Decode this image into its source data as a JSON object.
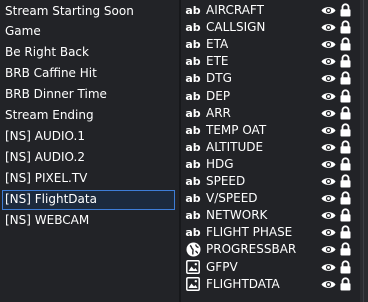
{
  "scenes": {
    "items": [
      {
        "label": "Stream Starting Soon",
        "selected": false
      },
      {
        "label": "Game",
        "selected": false
      },
      {
        "label": "Be Right Back",
        "selected": false
      },
      {
        "label": "BRB Caffine Hit",
        "selected": false
      },
      {
        "label": "BRB Dinner Time",
        "selected": false
      },
      {
        "label": "Stream Ending",
        "selected": false
      },
      {
        "label": "[NS] AUDIO.1",
        "selected": false
      },
      {
        "label": "[NS] AUDIO.2",
        "selected": false
      },
      {
        "label": "[NS] PIXEL.TV",
        "selected": false
      },
      {
        "label": "[NS] FlightData",
        "selected": true
      },
      {
        "label": "[NS] WEBCAM",
        "selected": false
      }
    ]
  },
  "sources": {
    "text_icon": "ab",
    "items": [
      {
        "label": "AIRCRAFT",
        "icon": "text-icon"
      },
      {
        "label": "CALLSIGN",
        "icon": "text-icon"
      },
      {
        "label": "ETA",
        "icon": "text-icon"
      },
      {
        "label": "ETE",
        "icon": "text-icon"
      },
      {
        "label": "DTG",
        "icon": "text-icon"
      },
      {
        "label": "DEP",
        "icon": "text-icon"
      },
      {
        "label": "ARR",
        "icon": "text-icon"
      },
      {
        "label": "TEMP OAT",
        "icon": "text-icon"
      },
      {
        "label": "ALTITUDE",
        "icon": "text-icon"
      },
      {
        "label": "HDG",
        "icon": "text-icon"
      },
      {
        "label": "SPEED",
        "icon": "text-icon"
      },
      {
        "label": "V/SPEED",
        "icon": "text-icon"
      },
      {
        "label": "NETWORK",
        "icon": "text-icon"
      },
      {
        "label": "FLIGHT PHASE",
        "icon": "text-icon"
      },
      {
        "label": "PROGRESSBAR",
        "icon": "browser-globe-icon"
      },
      {
        "label": "GFPV",
        "icon": "image-icon"
      },
      {
        "label": "FLIGHTDATA",
        "icon": "image-icon"
      }
    ]
  },
  "colors": {
    "panel_bg": "#222327",
    "selection_bg": "#1c2a3d",
    "selection_border": "#3e7dd6",
    "text": "#ffffff"
  }
}
